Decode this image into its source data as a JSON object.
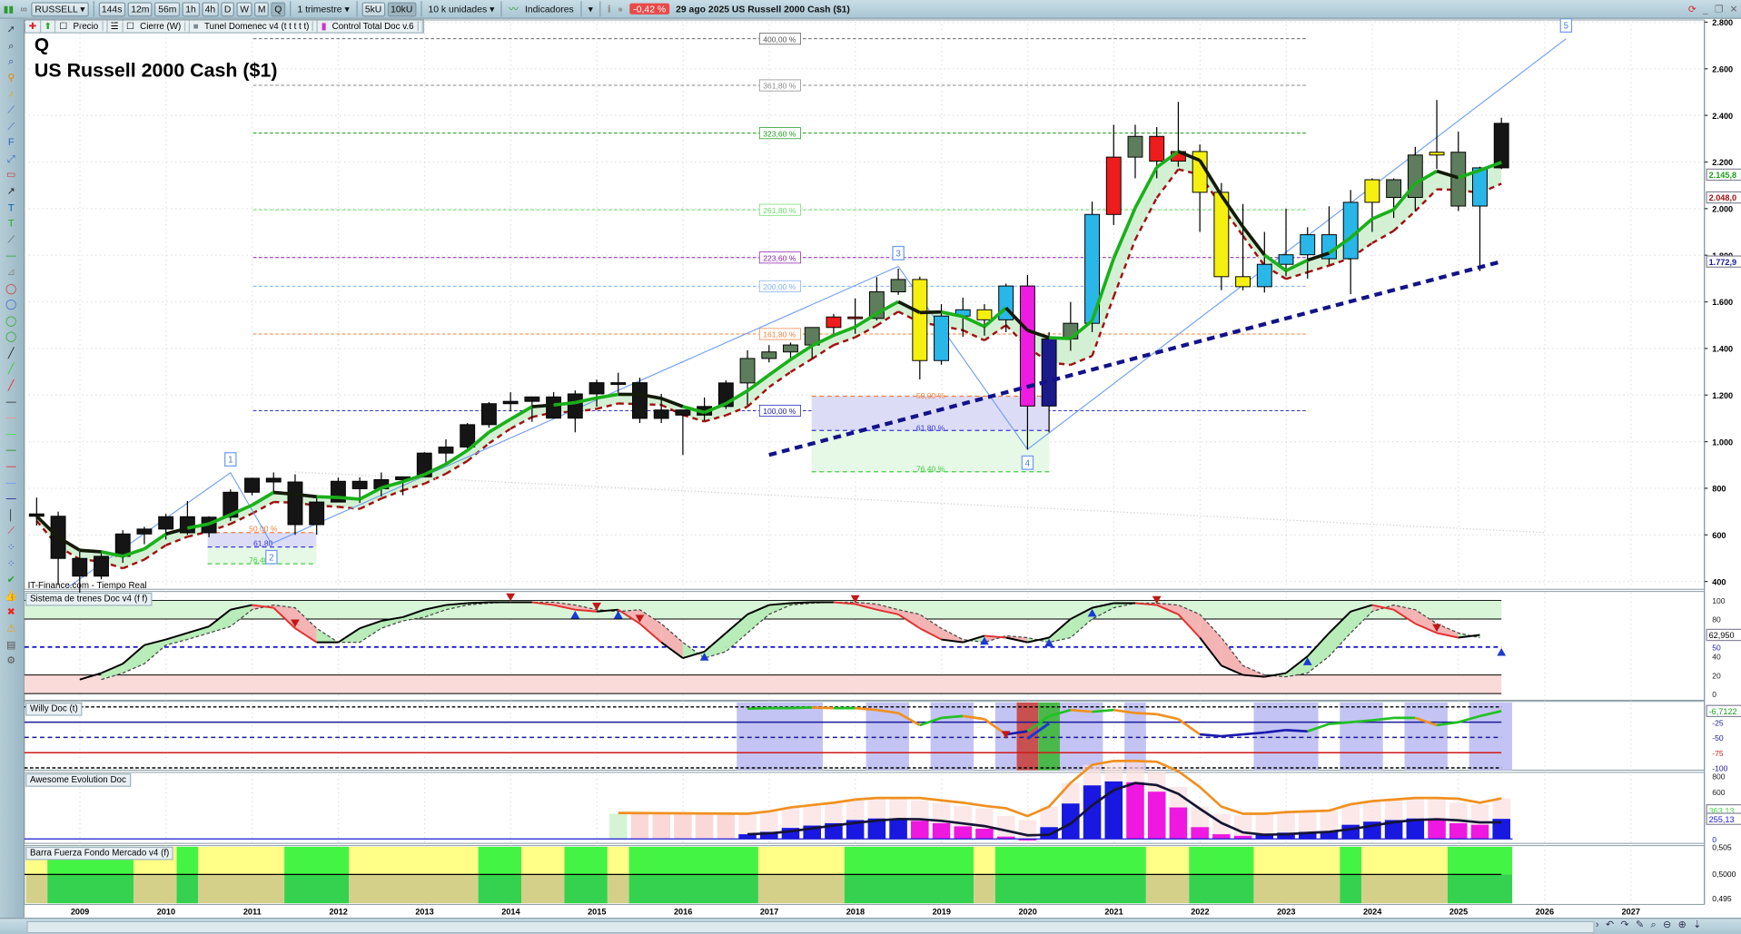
{
  "toolbar": {
    "symbol": "RUSSELL",
    "timeframes": [
      "144s",
      "12m",
      "56m",
      "1h",
      "4h",
      "D",
      "W",
      "M",
      "Q"
    ],
    "active_timeframe": "Q",
    "period": "1 trimestre",
    "units_buttons": [
      "5kU",
      "10kU"
    ],
    "units": "10 k unidades",
    "indicators": "Indicadores",
    "change": "-0,42 %",
    "date_title": "29 ago 2025  US Russell 2000 Cash ($1)",
    "change_color": "#e84a4a"
  },
  "legend": {
    "items": [
      "Precio",
      "Cierre (W)",
      "Tunel Domenec v4 (t t t t t)",
      "Control Total Doc v.6"
    ]
  },
  "chart": {
    "timeframe_letter": "Q",
    "instrument": "US Russell 2000 Cash ($1)",
    "watermark": "IT-Finance.com - Tiempo Real"
  },
  "price_axis": {
    "ticks": [
      "2.800",
      "2.600",
      "2.400",
      "2.200",
      "2.000",
      "1.800",
      "1.600",
      "1.400",
      "1.200",
      "1.000",
      "800",
      "600",
      "400"
    ],
    "tags": [
      {
        "label": "2.145,8",
        "value": 2145.8,
        "color": "#1aa01a"
      },
      {
        "label": "2.048,0",
        "value": 2048,
        "color": "#a01010"
      },
      {
        "label": "1.772,9",
        "value": 1772.9,
        "color": "#1a1a9a"
      }
    ]
  },
  "years": [
    "2009",
    "2010",
    "2011",
    "2012",
    "2013",
    "2014",
    "2015",
    "2016",
    "2017",
    "2018",
    "2019",
    "2020",
    "2021",
    "2022",
    "2023",
    "2024",
    "2025",
    "2026",
    "2027"
  ],
  "fib_levels": [
    {
      "label": "400,00 %",
      "price": 2729,
      "color": "#555"
    },
    {
      "label": "361,80 %",
      "price": 2529,
      "color": "#888"
    },
    {
      "label": "323,60 %",
      "price": 2324,
      "color": "#1a9a1a"
    },
    {
      "label": "261,80 %",
      "price": 1995,
      "color": "#66dd66"
    },
    {
      "label": "223,60 %",
      "price": 1790,
      "color": "#8a1ab0"
    },
    {
      "label": "200,00 %",
      "price": 1667,
      "color": "#7fb0ee"
    },
    {
      "label": "161,80 %",
      "price": 1462,
      "color": "#f08040"
    },
    {
      "label": "100,00 %",
      "price": 1133,
      "color": "#1a1ab0"
    }
  ],
  "fib_retrace_2020": [
    {
      "label": "50,00 %",
      "price": 1195,
      "color": "#f08040"
    },
    {
      "label": "61,80 %",
      "price": 1048,
      "color": "#3a3ad0"
    },
    {
      "label": "76,40 %",
      "price": 871,
      "color": "#44cc44"
    }
  ],
  "fib_retrace_2010": [
    {
      "label": "50,00 %",
      "price": 610,
      "color": "#f08040"
    },
    {
      "label": "61,80",
      "price": 548,
      "color": "#3a3ad0"
    },
    {
      "label": "76,40 %",
      "price": 476,
      "color": "#44cc44"
    }
  ],
  "waves": [
    {
      "label": "1",
      "q": 9,
      "price": 867
    },
    {
      "label": "2",
      "q": 10.9,
      "price": 562
    },
    {
      "label": "3",
      "q": 40,
      "price": 1752
    },
    {
      "label": "4",
      "q": 46,
      "price": 967
    },
    {
      "label": "5",
      "q": 71,
      "price": 2729
    }
  ],
  "panels": {
    "trenes": {
      "title": "Sistema de trenes Doc v4 (f f)",
      "ticks": [
        "100",
        "80",
        "50",
        "40",
        "20",
        "0"
      ],
      "value_tag": "62,950"
    },
    "willy": {
      "title": "Willy Doc (t)",
      "ticks": [
        "-25",
        "-50",
        "-75",
        "-100"
      ],
      "value_tag": "-6,7122"
    },
    "awesome": {
      "title": "Awesome Evolution Doc",
      "ticks": [
        "800",
        "600",
        "0"
      ],
      "tags": [
        "363,13",
        "255,13"
      ]
    },
    "barra": {
      "title": "Barra Fuerza Fondo Mercado v4 (f)",
      "ticks": [
        "0,505",
        "0,5000",
        "0,495"
      ]
    }
  },
  "chart_data": {
    "type": "candlestick",
    "title": "US Russell 2000 Cash ($1)",
    "timeframe": "quarterly",
    "first_quarter": "2008-Q3",
    "ylim": [
      400,
      2800
    ],
    "ohlc": [
      [
        690,
        760,
        640,
        680
      ],
      [
        680,
        700,
        385,
        499
      ],
      [
        499,
        530,
        343,
        423
      ],
      [
        423,
        530,
        410,
        508
      ],
      [
        508,
        620,
        480,
        604
      ],
      [
        604,
        635,
        560,
        625
      ],
      [
        625,
        690,
        580,
        678
      ],
      [
        678,
        745,
        600,
        609
      ],
      [
        609,
        680,
        590,
        676
      ],
      [
        676,
        795,
        660,
        783
      ],
      [
        783,
        845,
        770,
        843
      ],
      [
        843,
        868,
        780,
        827
      ],
      [
        827,
        860,
        600,
        644
      ],
      [
        644,
        770,
        601,
        741
      ],
      [
        741,
        846,
        740,
        830
      ],
      [
        830,
        847,
        737,
        798
      ],
      [
        798,
        868,
        765,
        837
      ],
      [
        837,
        850,
        770,
        849
      ],
      [
        849,
        955,
        849,
        951
      ],
      [
        951,
        1010,
        900,
        977
      ],
      [
        977,
        1080,
        970,
        1073
      ],
      [
        1073,
        1170,
        1060,
        1163
      ],
      [
        1163,
        1212,
        1130,
        1173
      ],
      [
        1173,
        1193,
        1085,
        1192
      ],
      [
        1192,
        1213,
        1100,
        1101
      ],
      [
        1101,
        1220,
        1040,
        1205
      ],
      [
        1205,
        1266,
        1150,
        1253
      ],
      [
        1253,
        1296,
        1210,
        1253
      ],
      [
        1253,
        1275,
        1080,
        1100
      ],
      [
        1100,
        1205,
        1080,
        1136
      ],
      [
        1136,
        1136,
        943,
        1114
      ],
      [
        1114,
        1190,
        1090,
        1151
      ],
      [
        1151,
        1263,
        1140,
        1252
      ],
      [
        1252,
        1392,
        1156,
        1357
      ],
      [
        1357,
        1414,
        1340,
        1385
      ],
      [
        1385,
        1425,
        1345,
        1415
      ],
      [
        1415,
        1490,
        1356,
        1490
      ],
      [
        1490,
        1548,
        1450,
        1535
      ],
      [
        1535,
        1615,
        1463,
        1529
      ],
      [
        1529,
        1706,
        1520,
        1643
      ],
      [
        1643,
        1742,
        1630,
        1696
      ],
      [
        1696,
        1708,
        1267,
        1348
      ],
      [
        1348,
        1590,
        1330,
        1539
      ],
      [
        1539,
        1618,
        1450,
        1566
      ],
      [
        1566,
        1590,
        1455,
        1523
      ],
      [
        1523,
        1678,
        1470,
        1668
      ],
      [
        1668,
        1715,
        966,
        1153
      ],
      [
        1153,
        1470,
        1040,
        1441
      ],
      [
        1441,
        1600,
        1390,
        1508
      ],
      [
        1508,
        2030,
        1470,
        1975
      ],
      [
        1975,
        2360,
        1930,
        2221
      ],
      [
        2221,
        2360,
        2130,
        2310
      ],
      [
        2310,
        2350,
        2130,
        2204
      ],
      [
        2204,
        2458,
        2180,
        2245
      ],
      [
        2245,
        2275,
        1900,
        2070
      ],
      [
        2070,
        2110,
        1650,
        1708
      ],
      [
        1708,
        2020,
        1650,
        1665
      ],
      [
        1665,
        1900,
        1640,
        1761
      ],
      [
        1761,
        2000,
        1710,
        1802
      ],
      [
        1802,
        1920,
        1700,
        1888
      ],
      [
        1888,
        2010,
        1760,
        1785
      ],
      [
        1785,
        2080,
        1633,
        2027
      ],
      [
        2027,
        2130,
        1900,
        2124
      ],
      [
        2124,
        2130,
        1960,
        2048
      ],
      [
        2048,
        2265,
        1990,
        2230
      ],
      [
        2230,
        2466,
        2170,
        2242
      ],
      [
        2242,
        2330,
        1990,
        2011
      ],
      [
        2011,
        2180,
        1732,
        2175
      ],
      [
        2175,
        2390,
        2170,
        2366
      ]
    ],
    "candle_colors": "kkkkkkkkkkkkkkkkkkkkkkkkkkkkkkkkkggggrrggyccycmngcrgrryyycccccyggygc",
    "color_map": {
      "k": "#151515",
      "g": "#5d7d5d",
      "r": "#ee1c1c",
      "y": "#f5f010",
      "c": "#29b6e8",
      "m": "#ee1ce0",
      "n": "#1a1a8a"
    },
    "support_trendline": [
      {
        "q": 34,
        "price": 943
      },
      {
        "q": 68,
        "price": 1772.9
      }
    ],
    "trenes": {
      "start_q": 2,
      "values": [
        15,
        22,
        32,
        52,
        58,
        65,
        72,
        90,
        95,
        92,
        70,
        55,
        55,
        70,
        78,
        82,
        90,
        95,
        97,
        98,
        98,
        98,
        95,
        90,
        88,
        90,
        75,
        55,
        38,
        45,
        65,
        85,
        95,
        97,
        98,
        98,
        96,
        90,
        85,
        70,
        58,
        55,
        62,
        60,
        55,
        60,
        80,
        92,
        97,
        97,
        95,
        85,
        60,
        30,
        20,
        18,
        22,
        40,
        65,
        88,
        95,
        90,
        75,
        65,
        60,
        62.95
      ],
      "down_marks_q": [
        12,
        22,
        26,
        28,
        38,
        52,
        65
      ],
      "up_marks_q": [
        25,
        27,
        31,
        44,
        47,
        49,
        59,
        68
      ]
    },
    "willy": {
      "start_q": 33,
      "values": [
        -3,
        -2,
        -2,
        -1,
        -2,
        -2,
        -5,
        -10,
        -30,
        -18,
        -15,
        -20,
        -45,
        -40,
        -15,
        -5,
        -8,
        -5,
        -10,
        -12,
        -20,
        -45,
        -48,
        -45,
        -42,
        -38,
        -40,
        -28,
        -25,
        -22,
        -18,
        -18,
        -30,
        -25,
        -15,
        -6.7122
      ],
      "shade_blue_q": [
        [
          33,
          37
        ],
        [
          39,
          41
        ],
        [
          42,
          44
        ],
        [
          45,
          46
        ],
        [
          48,
          50
        ],
        [
          51,
          52
        ],
        [
          57,
          60
        ],
        [
          61,
          63
        ],
        [
          64,
          66
        ],
        [
          67,
          69
        ]
      ],
      "shade_red_q": [
        [
          46,
          47
        ]
      ],
      "shade_green_q": [
        [
          47,
          48
        ]
      ]
    },
    "awesome": {
      "start_q": 33,
      "values": [
        60,
        90,
        140,
        170,
        200,
        240,
        260,
        260,
        230,
        200,
        160,
        130,
        30,
        -20,
        150,
        450,
        680,
        730,
        720,
        600,
        400,
        150,
        60,
        40,
        60,
        80,
        90,
        100,
        180,
        220,
        240,
        260,
        250,
        200,
        180,
        255.13
      ]
    },
    "barra": {
      "segments": [
        [
          "Y",
          0,
          1
        ],
        [
          "G",
          1,
          5
        ],
        [
          "Y",
          5,
          7
        ],
        [
          "G",
          7,
          8
        ],
        [
          "Y",
          8,
          12
        ],
        [
          "G",
          12,
          15
        ],
        [
          "Y",
          15,
          21
        ],
        [
          "G",
          21,
          23
        ],
        [
          "Y",
          23,
          25
        ],
        [
          "G",
          25,
          27
        ],
        [
          "Y",
          27,
          28
        ],
        [
          "G",
          28,
          34
        ],
        [
          "Y",
          34,
          38
        ],
        [
          "G",
          38,
          44
        ],
        [
          "Y",
          44,
          45
        ],
        [
          "G",
          45,
          52
        ],
        [
          "Y",
          52,
          54
        ],
        [
          "G",
          54,
          57
        ],
        [
          "Y",
          57,
          61
        ],
        [
          "G",
          61,
          62
        ],
        [
          "Y",
          62,
          66
        ],
        [
          "G",
          66,
          69
        ]
      ]
    }
  }
}
